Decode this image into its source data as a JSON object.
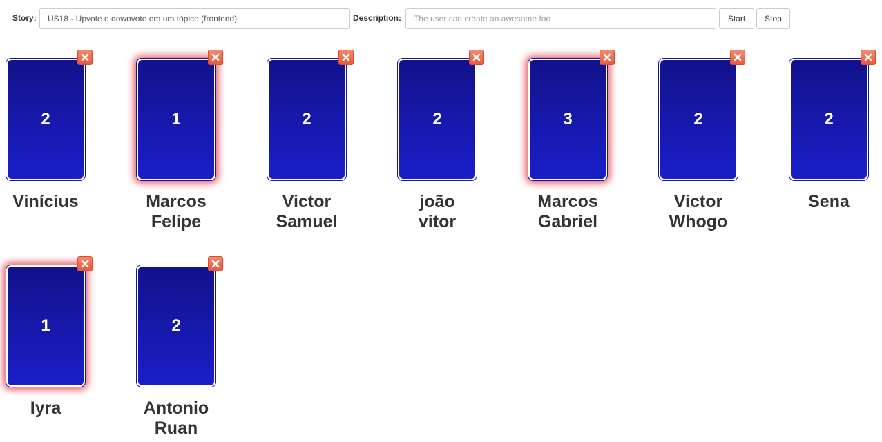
{
  "toolbar": {
    "story_label": "Story:",
    "story_value": "US18 - Upvote e downvote em um tópico (frontend)",
    "description_label": "Description:",
    "description_placeholder": "The user can create an awesome foo",
    "start_label": "Start",
    "stop_label": "Stop"
  },
  "icons": {
    "close": "close-x-icon"
  },
  "colors": {
    "card_gradient_top": "#12128c",
    "card_gradient_bottom": "#1a1ec8",
    "highlight_glow": "#e45060",
    "close_button": "#e8593f"
  },
  "players": [
    {
      "name_line1": "Vinícius",
      "name_line2": "",
      "vote": "2",
      "highlighted": false
    },
    {
      "name_line1": "Marcos",
      "name_line2": "Felipe",
      "vote": "1",
      "highlighted": true
    },
    {
      "name_line1": "Victor",
      "name_line2": "Samuel",
      "vote": "2",
      "highlighted": false
    },
    {
      "name_line1": "joão",
      "name_line2": "vitor",
      "vote": "2",
      "highlighted": false
    },
    {
      "name_line1": "Marcos",
      "name_line2": "Gabriel",
      "vote": "3",
      "highlighted": true
    },
    {
      "name_line1": "Victor",
      "name_line2": "Whogo",
      "vote": "2",
      "highlighted": false
    },
    {
      "name_line1": "Sena",
      "name_line2": "",
      "vote": "2",
      "highlighted": false
    },
    {
      "name_line1": "Iyra",
      "name_line2": "",
      "vote": "1",
      "highlighted": true
    },
    {
      "name_line1": "Antonio",
      "name_line2": "Ruan",
      "vote": "2",
      "highlighted": false
    }
  ]
}
